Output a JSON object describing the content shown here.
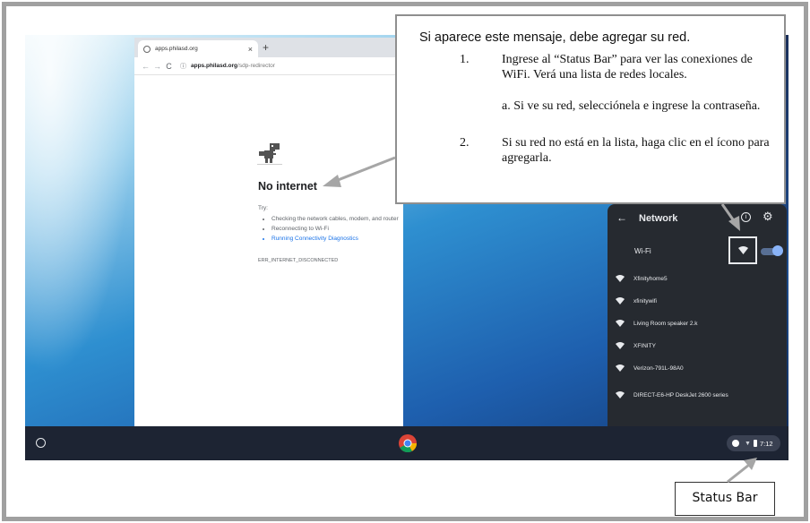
{
  "browser": {
    "tab_title": "apps.philasd.org",
    "tab_close": "×",
    "new_tab": "+",
    "url_host": "apps.philasd.org",
    "url_path": "/sdp-redirector"
  },
  "error_page": {
    "title": "No internet",
    "try_label": "Try:",
    "suggestions": [
      "Checking the network cables, modem, and router",
      "Reconnecting to Wi-Fi",
      "Running Connectivity Diagnostics"
    ],
    "error_code": "ERR_INTERNET_DISCONNECTED"
  },
  "network_panel": {
    "title": "Network",
    "wifi_label": "Wi-Fi",
    "wifi_enabled": true,
    "networks": [
      "Xfinityhome5",
      "xfinitywifi",
      "Living Room speaker 2.k",
      "XFINITY",
      "Verizon-791L-98A0",
      "DIRECT-E6-HP DeskJet 2600 series"
    ]
  },
  "shelf": {
    "time": "7:12"
  },
  "callout": {
    "heading": "Si aparece este mensaje, debe agregar su red.",
    "steps": [
      {
        "number": "1.",
        "text": "Ingrese al “Status Bar” para ver las conexiones de WiFi. Verá una lista de redes locales.",
        "sub": "a. Si ve su red, selecciónela e ingrese la contraseña."
      },
      {
        "number": "2.",
        "text": "Si su red no está en la lista, haga clic en el ícono para agregarla."
      }
    ]
  },
  "status_bar_label": "Status Bar",
  "colors": {
    "link": "#1a73e8",
    "panel_bg": "#262a30",
    "shelf_bg": "#1d2433",
    "toggle": "#8ab4f8",
    "frame_border": "#a0a0a0"
  }
}
